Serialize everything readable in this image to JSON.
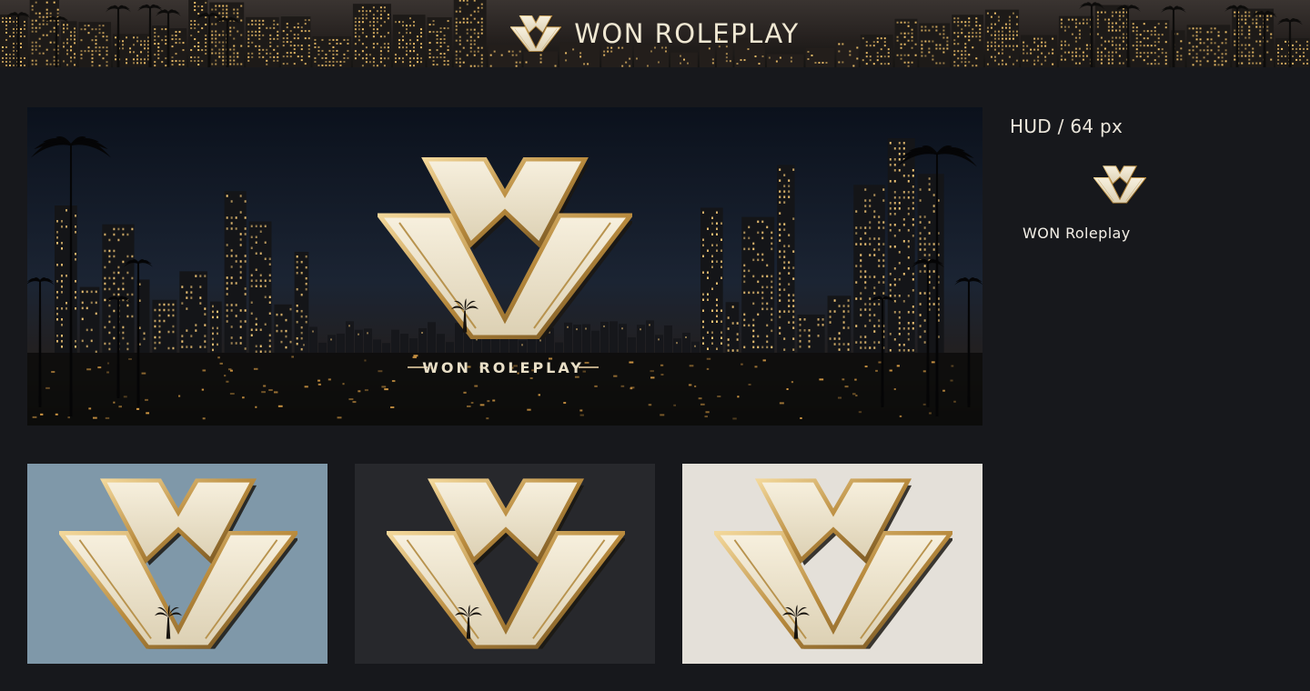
{
  "header": {
    "title": "WON ROLEPLAY",
    "logo_icon": "w-monogram-icon"
  },
  "banner": {
    "logo_icon": "w-monogram-palm-icon",
    "tagline": "WON ROLEPLAY",
    "scene": "city-skyline-night-with-palm-trees"
  },
  "tiles": [
    {
      "name": "logo-on-blue-gray",
      "background": "#7f98a9"
    },
    {
      "name": "logo-on-dark",
      "background": "#27282c"
    },
    {
      "name": "logo-on-light",
      "background": "#e4e0d9"
    }
  ],
  "hud": {
    "label": "HUD / 64 px",
    "icon": "w-monogram-small-icon",
    "name": "WON Roleplay"
  },
  "colors": {
    "page_background": "#17181c",
    "gold": "#c9a55f",
    "cream": "#efe5cc"
  }
}
